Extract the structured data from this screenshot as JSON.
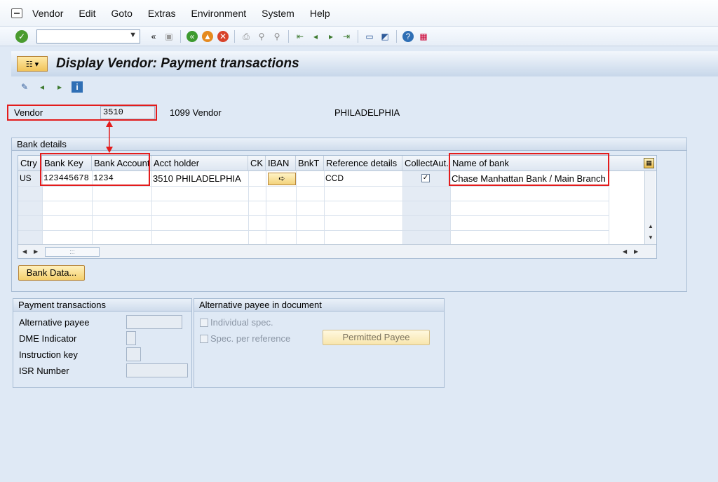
{
  "menubar": {
    "items": [
      "Vendor",
      "Edit",
      "Goto",
      "Extras",
      "Environment",
      "System",
      "Help"
    ]
  },
  "toolbar": {
    "command_value": "",
    "icons": [
      "enter-icon",
      "save-icon",
      "back-icon",
      "exit-icon",
      "cancel-icon",
      "print-icon",
      "find-icon",
      "find-next-icon",
      "first-page-icon",
      "previous-page-icon",
      "next-page-icon",
      "last-page-icon",
      "create-session-icon",
      "shortcut-icon",
      "help-icon",
      "customize-layout-icon"
    ]
  },
  "title": {
    "text": "Display Vendor: Payment transactions"
  },
  "vendor": {
    "label": "Vendor",
    "number": "3510",
    "name": "1099 Vendor",
    "city": "PHILADELPHIA"
  },
  "bank_details": {
    "title": "Bank details",
    "columns": [
      "Ctry",
      "Bank Key",
      "Bank Account",
      "Acct holder",
      "CK",
      "IBAN",
      "BnkT",
      "Reference details",
      "CollectAut.",
      "Name of bank"
    ],
    "rows": [
      {
        "ctry": "US",
        "bank_key": "123445678",
        "bank_account": "1234",
        "acct_holder": "3510 PHILADELPHIA",
        "ck": "",
        "bnkt": "",
        "reference": "CCD",
        "collect_aut": true,
        "bank_name": "Chase Manhattan Bank / Main Branch"
      }
    ],
    "bank_data_button": "Bank Data..."
  },
  "payment_transactions": {
    "title": "Payment transactions",
    "fields": [
      {
        "label": "Alternative payee",
        "value": ""
      },
      {
        "label": "DME Indicator",
        "value": ""
      },
      {
        "label": "Instruction key",
        "value": ""
      },
      {
        "label": "ISR Number",
        "value": ""
      }
    ]
  },
  "alt_payee_doc": {
    "title": "Alternative payee in document",
    "individual_spec": "Individual spec.",
    "spec_per_reference": "Spec. per reference",
    "permitted_payee_button": "Permitted Payee"
  },
  "colors": {
    "highlight": "#e31c1c",
    "background": "#dfe9f5",
    "button": "#f4cf6b"
  }
}
